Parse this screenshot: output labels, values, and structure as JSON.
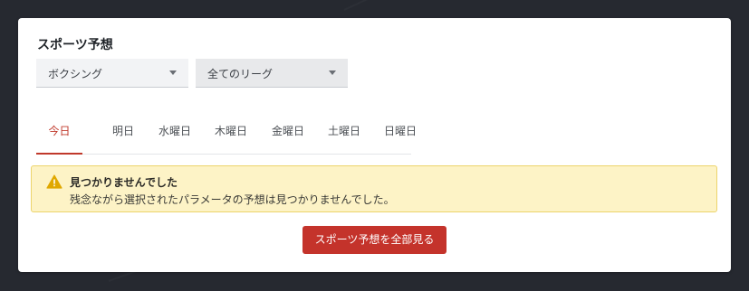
{
  "panel": {
    "title": "スポーツ予想"
  },
  "filters": {
    "sport": "ボクシング",
    "league": "全てのリーグ"
  },
  "tabs": [
    {
      "label": "今日",
      "active": true
    },
    {
      "label": "明日",
      "active": false
    },
    {
      "label": "水曜日",
      "active": false
    },
    {
      "label": "木曜日",
      "active": false
    },
    {
      "label": "金曜日",
      "active": false
    },
    {
      "label": "土曜日",
      "active": false
    },
    {
      "label": "日曜日",
      "active": false
    }
  ],
  "alert": {
    "icon": "warning-icon",
    "title": "見つかりませんでした",
    "message": "残念ながら選択されたパラメータの予想は見つかりませんでした。"
  },
  "cta": {
    "label": "スポーツ予想を全部見る"
  },
  "colors": {
    "accent": "#c0392b",
    "background": "#262930",
    "alert_bg": "#fdf3c6",
    "alert_border": "#ecd46b",
    "warning_icon": "#e0a800"
  }
}
